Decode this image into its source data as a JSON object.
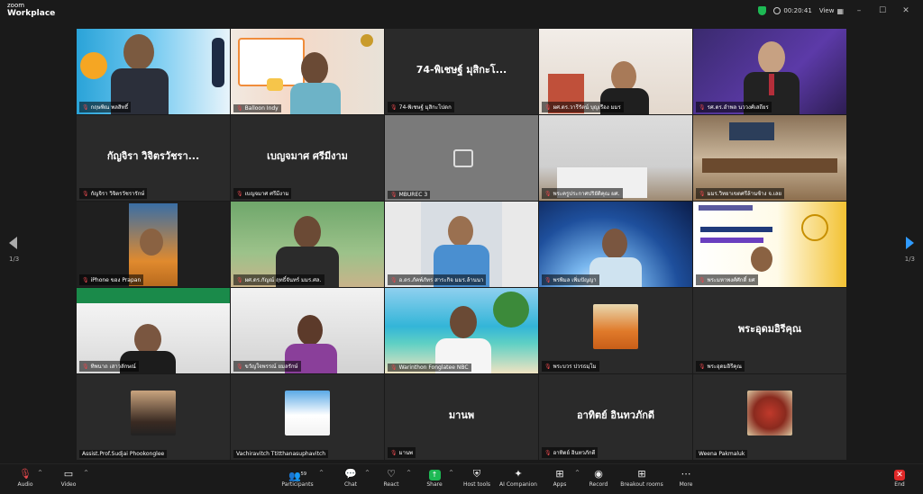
{
  "app": {
    "line1": "zoom",
    "line2": "Workplace",
    "timer": "00:20:41",
    "view_label": "View"
  },
  "nav": {
    "page_left": "1/3",
    "page_right": "1/3"
  },
  "tiles": [
    {
      "name": "กฤษพิณ พลสิทธิ์",
      "big": ""
    },
    {
      "name": "Balloon Indy",
      "big": ""
    },
    {
      "name": "74-พิเชษฐ์ มุสิกะโปดก",
      "big": "74-พิเชษฐ์ มุสิกะโ..."
    },
    {
      "name": "ผศ.ดร.วารีรัตน์ บุญเรือง มมร",
      "big": ""
    },
    {
      "name": "รศ.ดร.อำพล นววงศ์เสถียร",
      "big": ""
    },
    {
      "name": "กัญจิรา วิจิตรวัชรารักษ์",
      "big": "กัญจิรา วิจิตรวัชรา..."
    },
    {
      "name": "เบญจมาศ ศรีมีงาม",
      "big": "เบญจมาศ ศรีมีงาม"
    },
    {
      "name": "MBUREC 3",
      "big": ""
    },
    {
      "name": "พระครูประกาศปริยัติคุณ ผศ.",
      "big": ""
    },
    {
      "name": "มมร.วิทยาเขตศรีล้านช้าง จ.เลย",
      "big": ""
    },
    {
      "name": "iPhone ของ Prapan",
      "big": ""
    },
    {
      "name": "ผศ.ดร.กัญณ์ ฤทธิ์จันทร์ มมร.ศล.",
      "big": ""
    },
    {
      "name": "อ.ดร.ภัคพ์ภัทร สาระกิจ มมร.ล้านนา",
      "big": ""
    },
    {
      "name": "พรพิมล เพิ่มปัญญา",
      "big": ""
    },
    {
      "name": "พระมหาพงศ์ศักดิ์ ยศ",
      "big": ""
    },
    {
      "name": "ทิพนาถ เสาวลักษณ์",
      "big": ""
    },
    {
      "name": "ขวัญใจพรรณ์ ยมลรักษ์",
      "big": ""
    },
    {
      "name": "Warinthon Fonglatee NBC",
      "big": ""
    },
    {
      "name": "พระบวร ปวรธมฺโม",
      "big": ""
    },
    {
      "name": "พระอุดมอิรีคุณ",
      "big": "พระอุดมอิรีคุณ"
    },
    {
      "name": "Assist.Prof.Sudjai Phookonglee",
      "big": ""
    },
    {
      "name": "Vachiravitch Ttitthanasuphavitch",
      "big": ""
    },
    {
      "name": "มานพ",
      "big": "มานพ"
    },
    {
      "name": "อาทิตย์ อินทวภักดี",
      "big": "อาทิตย์ อินทวภักดี"
    },
    {
      "name": "Weena Pakmaluk",
      "big": ""
    }
  ],
  "toolbar": {
    "audio": "Audio",
    "video": "Video",
    "participants": "Participants",
    "participants_count": "59",
    "chat": "Chat",
    "react": "React",
    "share": "Share",
    "host_tools": "Host tools",
    "ai_companion": "AI Companion",
    "apps": "Apps",
    "record": "Record",
    "breakout": "Breakout rooms",
    "more": "More",
    "end": "End"
  }
}
